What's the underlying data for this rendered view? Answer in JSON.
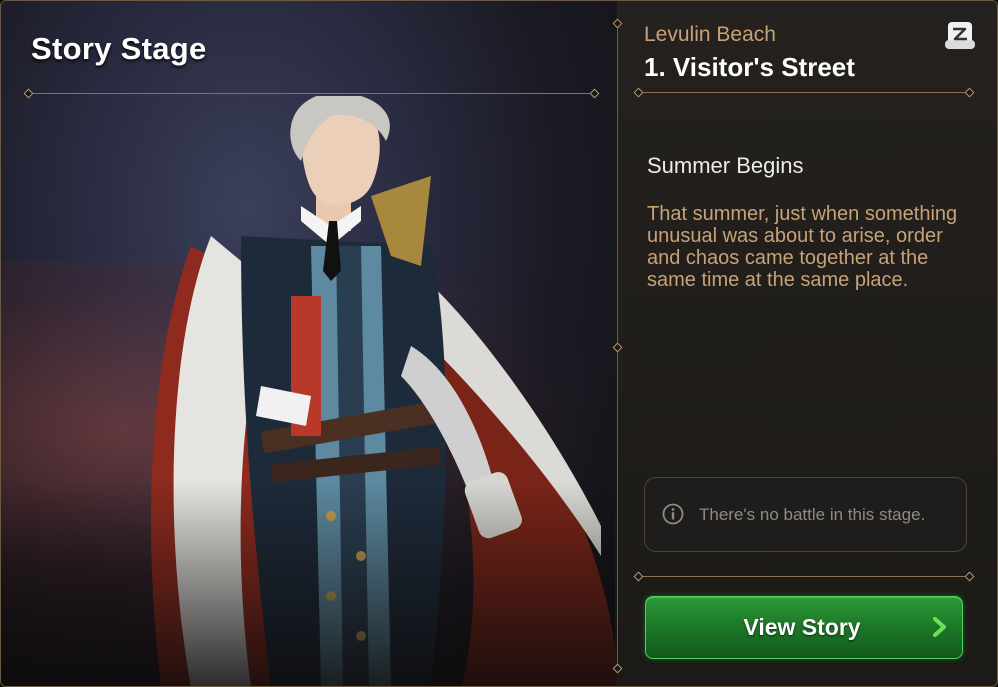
{
  "header": {
    "title": "Story Stage"
  },
  "stage": {
    "region": "Levulin Beach",
    "name": "1. Visitor's Street"
  },
  "episode": {
    "title": "Summer Begins",
    "description": "That summer, just when something unusual was about to arise, order and chaos came together at the same time at the same place."
  },
  "notice": {
    "text": "There's no battle in this stage.",
    "icon": "info-icon"
  },
  "actions": {
    "view_story_label": "View Story",
    "arrow_icon": "chevron-right-icon"
  },
  "icons": {
    "top_right": "scroll-icon"
  },
  "colors": {
    "accent_gold": "#c8a277",
    "button_green": "#1d7a28",
    "arrow_green": "#6fe05a"
  }
}
